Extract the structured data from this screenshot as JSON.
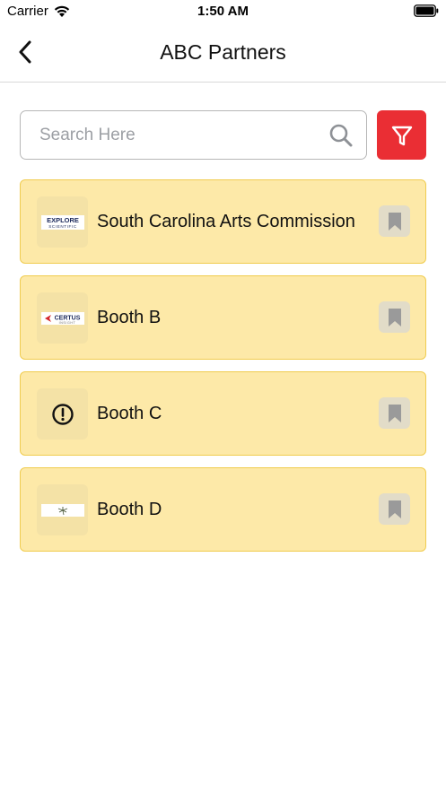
{
  "status_bar": {
    "carrier": "Carrier",
    "time": "1:50 AM",
    "icons": [
      "wifi-icon",
      "battery-icon"
    ]
  },
  "nav": {
    "title": "ABC Partners",
    "back_icon": "chevron-left-icon"
  },
  "search": {
    "placeholder": "Search Here",
    "value": "",
    "icon": "search-icon"
  },
  "filter": {
    "icon": "filter-icon",
    "color": "#ea2e34"
  },
  "partners": [
    {
      "name": "South Carolina Arts Commission",
      "logo": "explore-scientific-logo",
      "logo_text_1": "EXPLORE",
      "logo_text_2": "SCIENTIFIC"
    },
    {
      "name": "Booth B",
      "logo": "certus-insight-logo",
      "logo_text_1": "CERTUS",
      "logo_text_2": "INSIGHT"
    },
    {
      "name": "Booth C",
      "logo": "alert-circle-icon"
    },
    {
      "name": "Booth D",
      "logo": "palm-tree-logo"
    }
  ],
  "colors": {
    "card_background": "#fde9a8",
    "card_border": "#f0cc4f",
    "bookmark_icon": "#9a9a9a"
  }
}
